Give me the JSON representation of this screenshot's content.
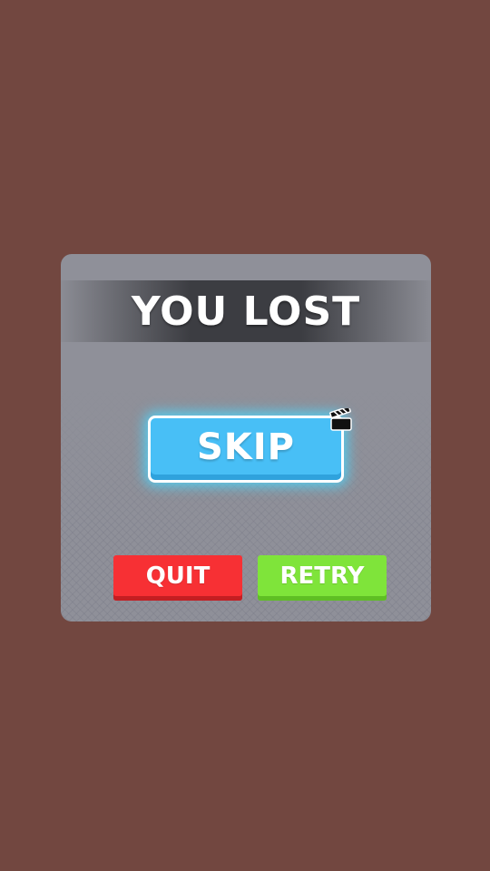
{
  "dialog": {
    "title": "YOU LOST",
    "skip_label": "SKIP",
    "skip_badge_icon": "video-clapperboard-icon",
    "quit_label": "QUIT",
    "retry_label": "RETRY"
  },
  "colors": {
    "background": "#724740",
    "panel": "#8f9099",
    "title_banner": "#3c3d42",
    "skip_button": "#48bff6",
    "skip_glow": "#4bd7ff",
    "quit_button": "#f73034",
    "retry_button": "#7fe43a"
  }
}
